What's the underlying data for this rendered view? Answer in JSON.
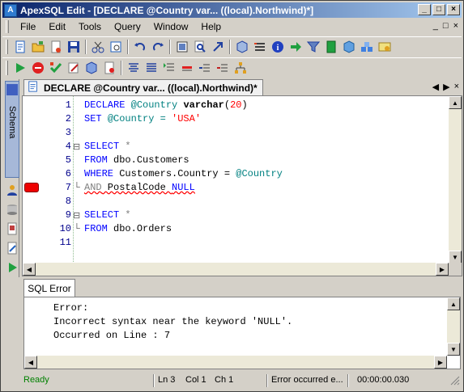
{
  "titlebar": {
    "title": "ApexSQL Edit - [DECLARE @Country var... ((local).Northwind)*]",
    "controls": {
      "minimize": "_",
      "restore": "□",
      "close": "×"
    }
  },
  "menubar": {
    "items": [
      "File",
      "Edit",
      "Tools",
      "Query",
      "Window",
      "Help"
    ],
    "right_controls": {
      "minimize": "_",
      "restore": "□",
      "close": "×"
    }
  },
  "toolbar1": {
    "icons": [
      "new-query-icon",
      "open-folder-icon",
      "open-file-icon",
      "save-icon",
      "cut-icon",
      "preview-icon",
      "undo-icon",
      "redo-icon",
      "format-icon",
      "find-icon",
      "goto-icon",
      "cube-icon",
      "list-icon",
      "info-icon",
      "arrow-right-icon",
      "filter-icon",
      "book-icon",
      "package-icon",
      "blocks-icon",
      "certificate-icon"
    ]
  },
  "toolbar2": {
    "icons": [
      "execute-icon",
      "stop-icon",
      "check-icon",
      "edit-icon",
      "connect-icon",
      "disconnect-icon",
      "align-center-icon",
      "align-justify-icon",
      "comment-icon",
      "uncomment-icon",
      "indent-icon",
      "outdent-icon",
      "hierarchy-icon"
    ]
  },
  "sidepanel": {
    "schema_label": "Schema",
    "buttons": [
      "user-icon",
      "database-icon",
      "document-icon",
      "edit-doc-icon",
      "run-icon"
    ]
  },
  "doc_tab": {
    "label": "DECLARE @Country var... ((local).Northwind)*",
    "nav_prev": "◀",
    "nav_next": "▶",
    "nav_close": "×"
  },
  "editor": {
    "line_numbers": [
      "1",
      "2",
      "3",
      "4",
      "5",
      "6",
      "7",
      "8",
      "9",
      "10",
      "11"
    ],
    "fold_markers": {
      "4": "⊟",
      "7": "└",
      "9": "⊟",
      "10": "└"
    },
    "lines": {
      "l1": {
        "declare": "DECLARE",
        "var": "@Country",
        "type": "varchar",
        "paren_open": "(",
        "num": "20",
        "paren_close": ")"
      },
      "l2": {
        "set": "SET",
        "var": "@Country",
        "eq": " = ",
        "str": "'USA'"
      },
      "l4": {
        "select": "SELECT",
        "star": " *"
      },
      "l5": {
        "from": "FROM",
        "rest": " dbo.Customers"
      },
      "l6": {
        "where": "WHERE",
        "rest": " Customers.Country = ",
        "var": "@Country"
      },
      "l7": {
        "and": "AND",
        "rest": " PostalCode ",
        "null": "NULL"
      },
      "l9": {
        "select": "SELECT",
        "star": " *"
      },
      "l10": {
        "from": "FROM",
        "rest": " dbo.Orders"
      }
    }
  },
  "bottompanel": {
    "tab_label": "SQL Error",
    "lines": [
      "Error:",
      "Incorrect syntax near the keyword 'NULL'.",
      "Occurred on Line : 7"
    ]
  },
  "statusbar": {
    "ready": "Ready",
    "ln": "Ln 3",
    "col": "Col 1",
    "ch": "Ch 1",
    "message": "Error occurred e...",
    "time": "00:00:00.030"
  },
  "colors": {
    "title_start": "#0a246a",
    "title_end": "#a6caf0",
    "keyword": "#0000ff",
    "variable": "#008080",
    "string": "#ff0000",
    "ready": "#008000"
  }
}
